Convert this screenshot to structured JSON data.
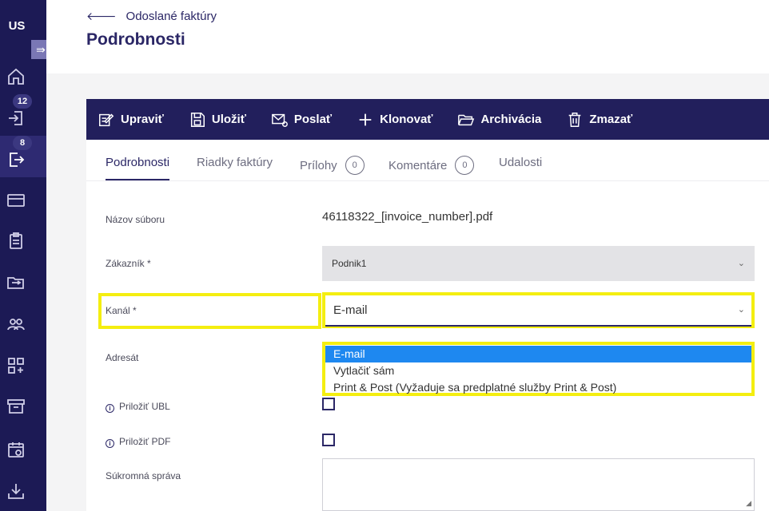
{
  "sidebar": {
    "logo": "US",
    "collapse_icon": "expand-arrow-icon",
    "items": [
      {
        "icon": "home-icon",
        "badge": ""
      },
      {
        "icon": "inbox-import-icon",
        "badge": "12"
      },
      {
        "icon": "outbox-export-icon",
        "badge": "8"
      },
      {
        "icon": "credit-card-icon",
        "badge": ""
      },
      {
        "icon": "clipboard-icon",
        "badge": ""
      },
      {
        "icon": "folder-transfer-icon",
        "badge": ""
      },
      {
        "icon": "users-icon",
        "badge": ""
      },
      {
        "icon": "apps-add-icon",
        "badge": ""
      },
      {
        "icon": "archive-icon",
        "badge": ""
      },
      {
        "icon": "calendar-sync-icon",
        "badge": ""
      },
      {
        "icon": "download-icon",
        "badge": ""
      }
    ]
  },
  "header": {
    "back_label": "Odoslané faktúry",
    "title": "Podrobnosti"
  },
  "toolbar": {
    "edit": "Upraviť",
    "save": "Uložiť",
    "send": "Poslať",
    "clone": "Klonovať",
    "archive": "Archivácia",
    "delete": "Zmazať"
  },
  "tabs": {
    "details": "Podrobnosti",
    "lines": "Riadky faktúry",
    "attachments": "Prílohy",
    "attachments_count": "0",
    "comments": "Komentáre",
    "comments_count": "0",
    "events": "Udalosti"
  },
  "form": {
    "filename_label": "Názov súboru",
    "filename_value": "46118322_[invoice_number].pdf",
    "customer_label": "Zákazník *",
    "customer_value": "Podnik1",
    "channel_label": "Kanál *",
    "channel_value": "E-mail",
    "channel_options": [
      "E-mail",
      "Vytlačiť sám",
      "Print & Post (Vyžaduje sa predplatné služby Print & Post)"
    ],
    "recipient_label": "Adresát",
    "attach_ubl_label": "Priložiť UBL",
    "attach_pdf_label": "Priložiť PDF",
    "private_message_label": "Súkromná správa"
  },
  "colors": {
    "sidebar": "#1c1a55",
    "toolbar": "#221f5c",
    "accent": "#2b2766",
    "highlight": "#f4ee10",
    "option_selected": "#1e88f0"
  }
}
